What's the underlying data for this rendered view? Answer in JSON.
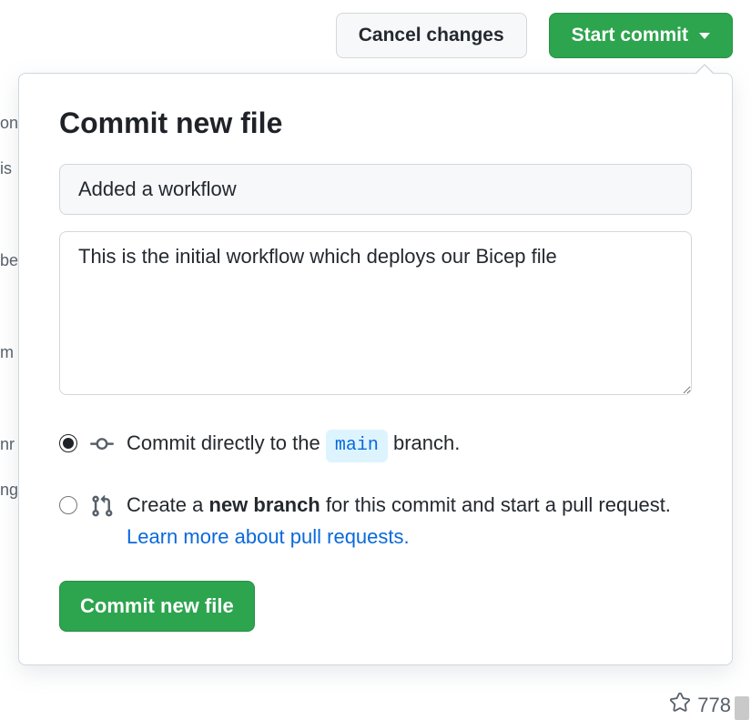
{
  "topbar": {
    "cancel_label": "Cancel changes",
    "start_commit_label": "Start commit"
  },
  "popover": {
    "heading": "Commit new file",
    "commit_title_value": "Added a workflow",
    "commit_title_placeholder": "",
    "commit_description_value": "This is the initial workflow which deploys our Bicep file",
    "commit_description_placeholder": "",
    "radios": {
      "direct": {
        "prefix": "Commit directly to the ",
        "branch": "main",
        "suffix": " branch.",
        "selected": true
      },
      "new_branch": {
        "prefix": "Create a ",
        "bold": "new branch",
        "suffix": " for this commit and start a pull request. ",
        "learn_more": "Learn more about pull requests.",
        "selected": false
      }
    },
    "submit_label": "Commit new file"
  },
  "bg_bottom": {
    "count": "778"
  }
}
